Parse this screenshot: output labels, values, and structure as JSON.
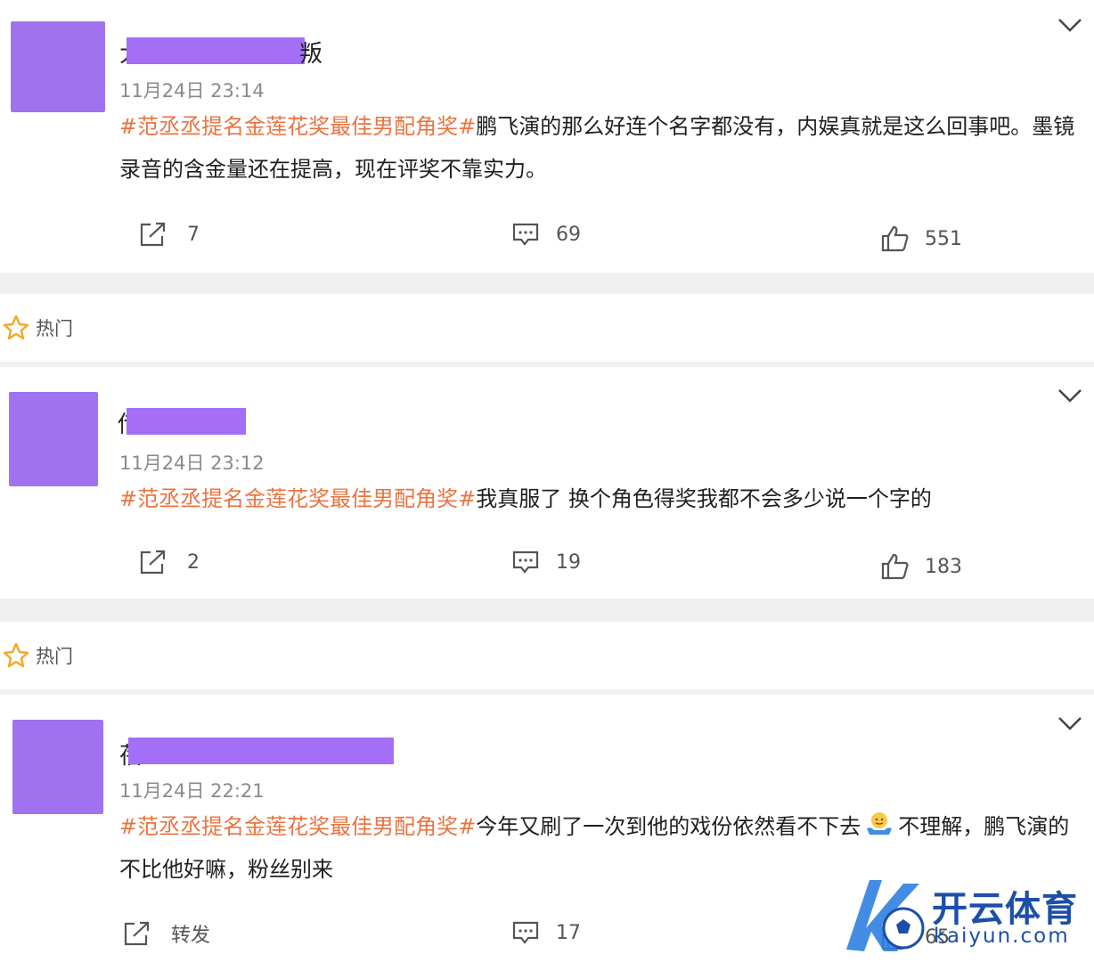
{
  "hot_label": "热门",
  "posts": [
    {
      "name_initial": "大",
      "name_tail": "叛",
      "time": "11月24日 23:14",
      "hashtag": "#范丞丞提名金莲花奖最佳男配角奖#",
      "body": "鹏飞演的那么好连个名字都没有，内娱真就是这么回事吧。墨镜录音的含金量还在提高，现在评奖不靠实力。",
      "repost": "7",
      "comments": "69",
      "likes": "551"
    },
    {
      "name_initial": "传",
      "time": "11月24日 23:12",
      "hashtag": "#范丞丞提名金莲花奖最佳男配角奖#",
      "body": "我真服了 换个角色得奖我都不会多少说一个字的",
      "repost": "2",
      "comments": "19",
      "likes": "183"
    },
    {
      "name_initial": "蓓",
      "time": "11月24日 22:21",
      "hashtag": "#范丞丞提名金莲花奖最佳男配角奖#",
      "body_before_emoji": "今年又刷了一次到他的戏份依然看不下去",
      "body_after_emoji": "不理解，鹏飞演的不比他好嘛，粉丝别来",
      "repost": "转发",
      "comments": "17",
      "likes": "65"
    }
  ],
  "watermark": {
    "cn": "开云体育",
    "en": "kaiyun.com"
  },
  "colors": {
    "hashtag": "#eb7340",
    "avatar": "#a072f0",
    "star": "#f5a623",
    "logo": "#1c4fa8"
  }
}
